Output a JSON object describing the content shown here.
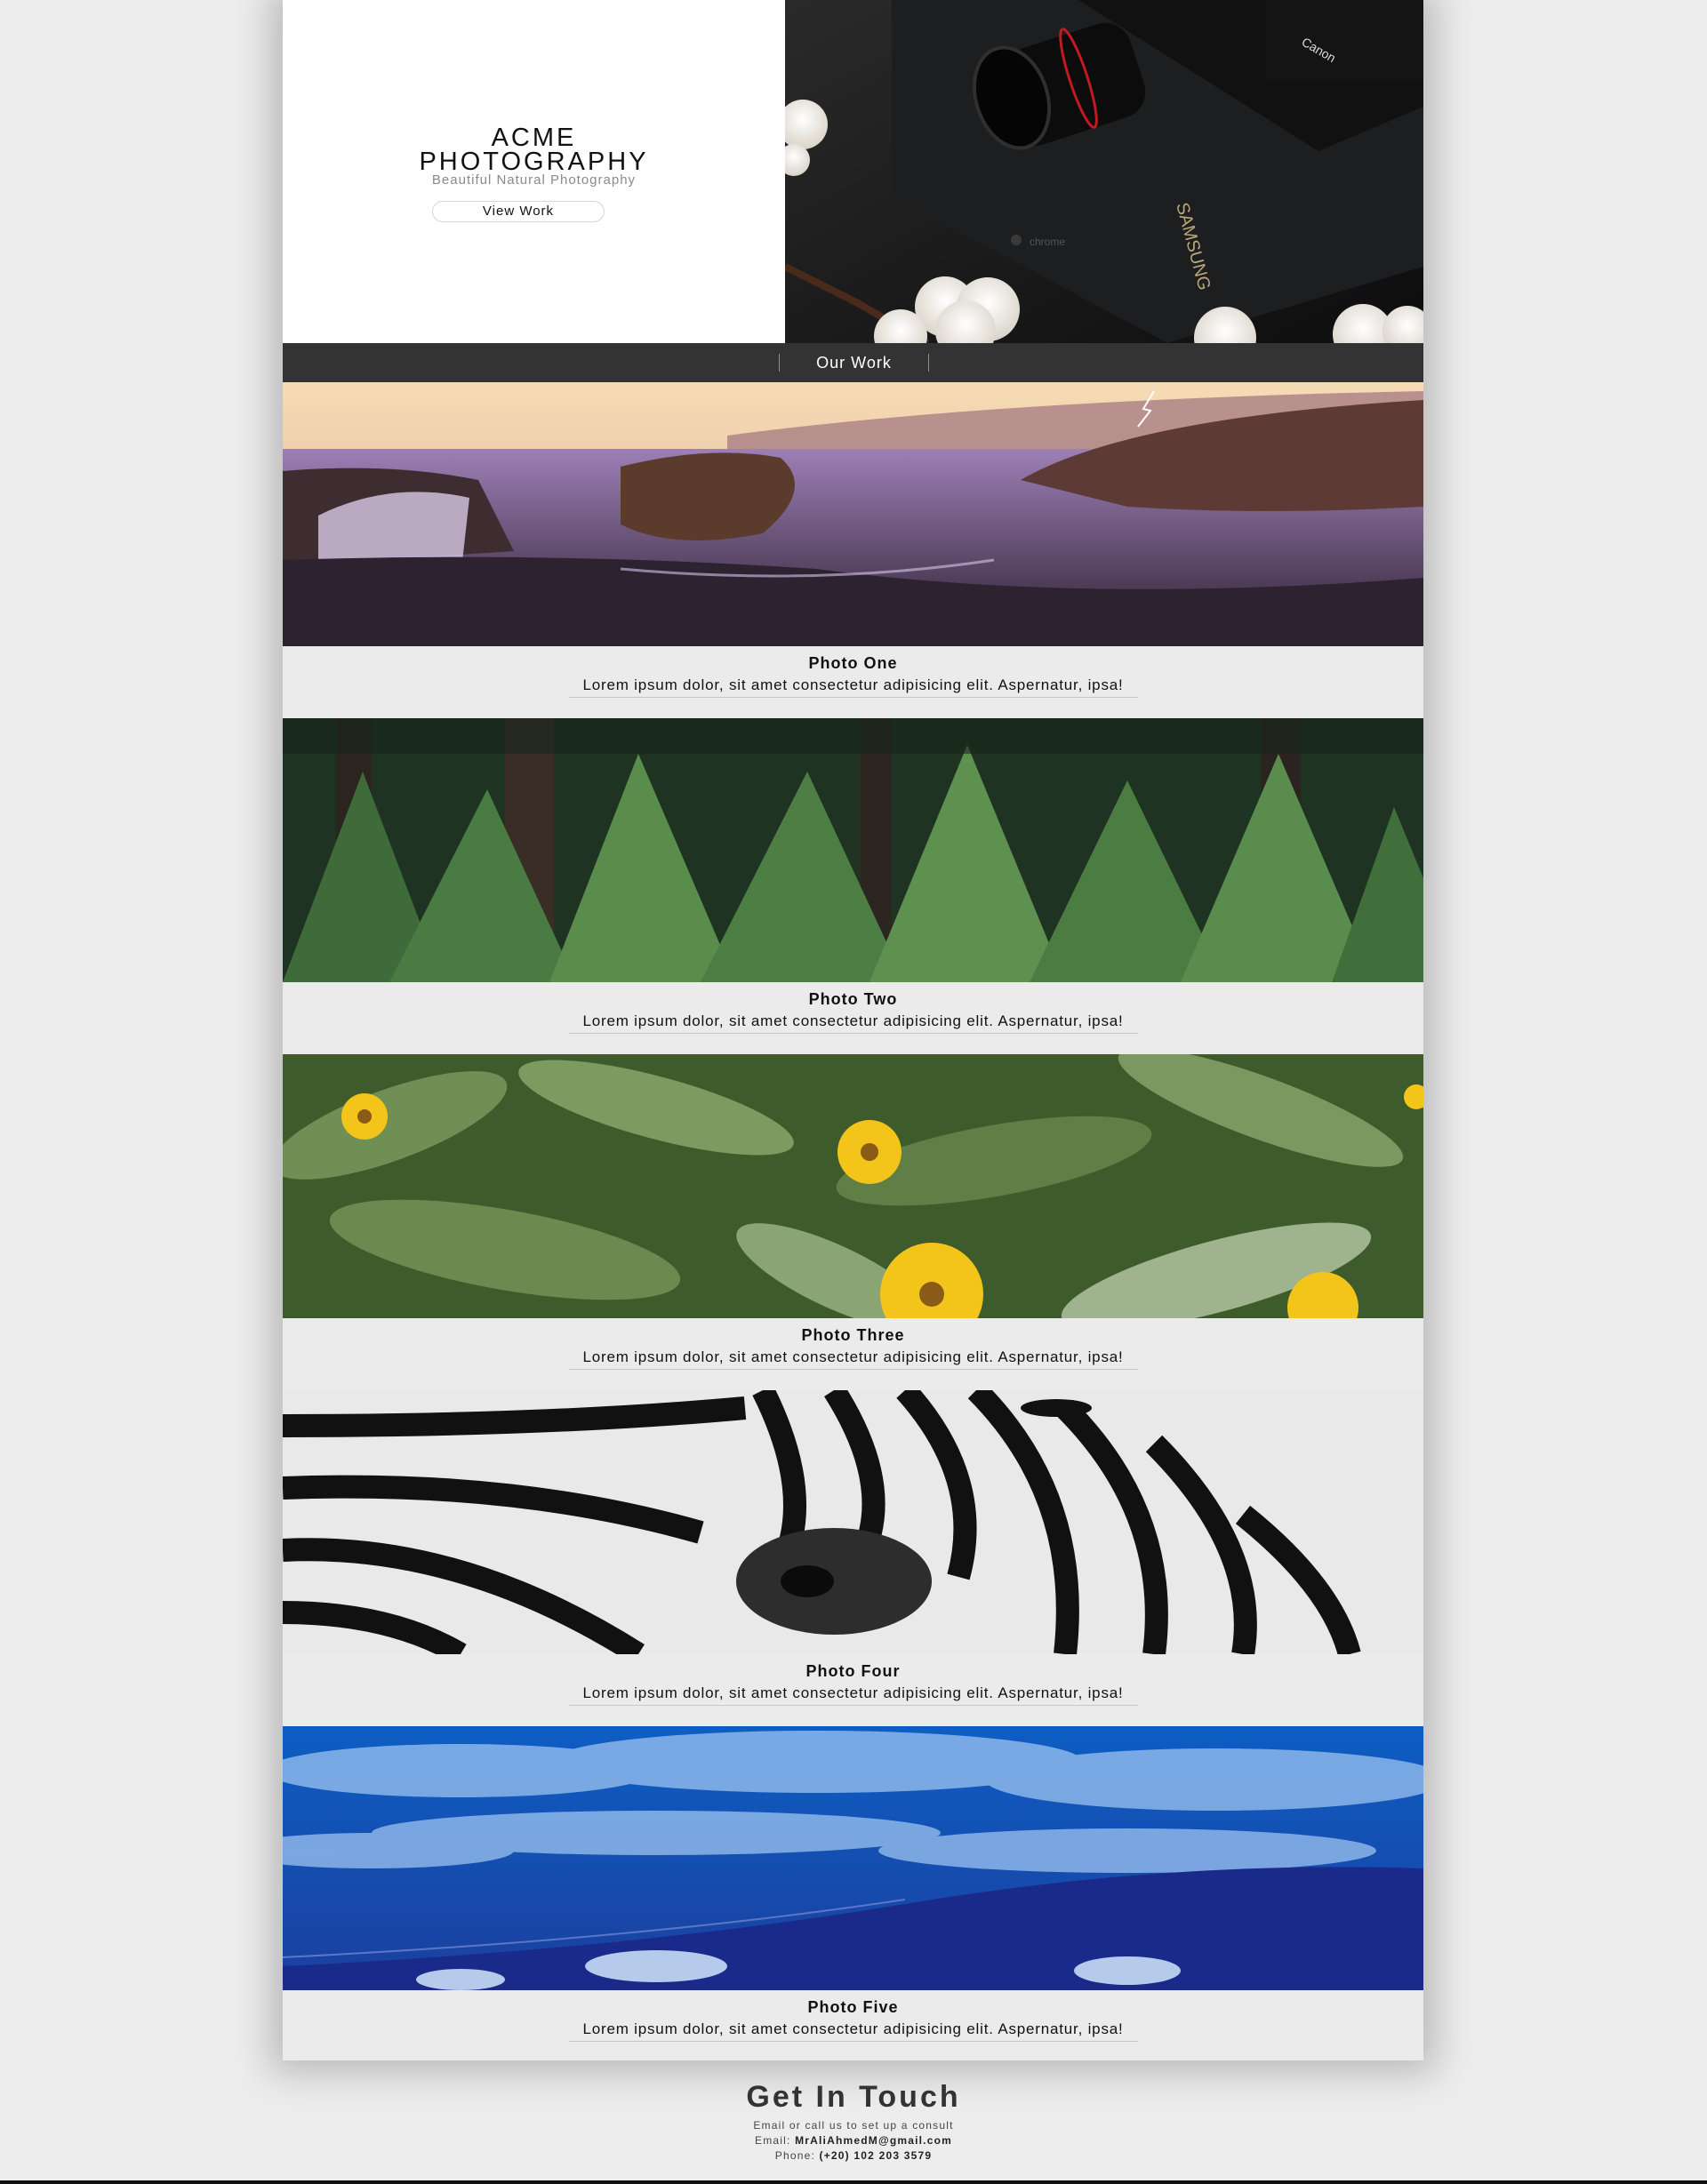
{
  "hero": {
    "title_line1": "ACME",
    "title_line2": "PHOTOGRAPHY",
    "subtitle": "Beautiful Natural Photography",
    "button_label": "View Work"
  },
  "nav": {
    "label": "Our Work"
  },
  "photos": [
    {
      "title": "Photo One",
      "description": "Lorem ipsum dolor, sit amet consectetur adipisicing elit. Aspernatur, ipsa!"
    },
    {
      "title": "Photo Two",
      "description": "Lorem ipsum dolor, sit amet consectetur adipisicing elit. Aspernatur, ipsa!"
    },
    {
      "title": "Photo Three",
      "description": "Lorem ipsum dolor, sit amet consectetur adipisicing elit. Aspernatur, ipsa!"
    },
    {
      "title": "Photo Four",
      "description": "Lorem ipsum dolor, sit amet consectetur adipisicing elit. Aspernatur, ipsa!"
    },
    {
      "title": "Photo Five",
      "description": "Lorem ipsum dolor, sit amet consectetur adipisicing elit. Aspernatur, ipsa!"
    }
  ],
  "contact": {
    "title": "Get In Touch",
    "intro": "Email or call us to set up a consult",
    "email_label": "Email:",
    "email": "MrAliAhmedM@gmail.com",
    "phone_label": "Phone:",
    "phone": "(+20) 102 203 3579"
  },
  "colors": {
    "nav_bg": "#333333",
    "page_bg": "#ededed",
    "content_bg": "#ebebeb"
  }
}
